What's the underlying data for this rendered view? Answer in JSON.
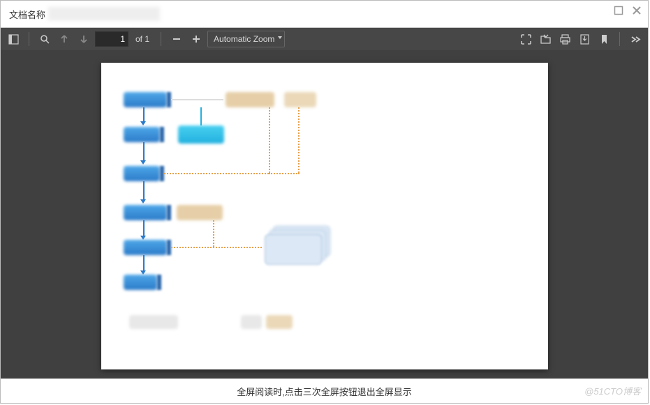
{
  "titlebar": {
    "label": "文档名称"
  },
  "toolbar": {
    "page_current": "1",
    "page_of_label": "of 1",
    "zoom_label": "Automatic Zoom"
  },
  "footer": {
    "hint": "全屏阅读时,点击三次全屏按钮退出全屏显示",
    "watermark": "@51CTO博客"
  }
}
